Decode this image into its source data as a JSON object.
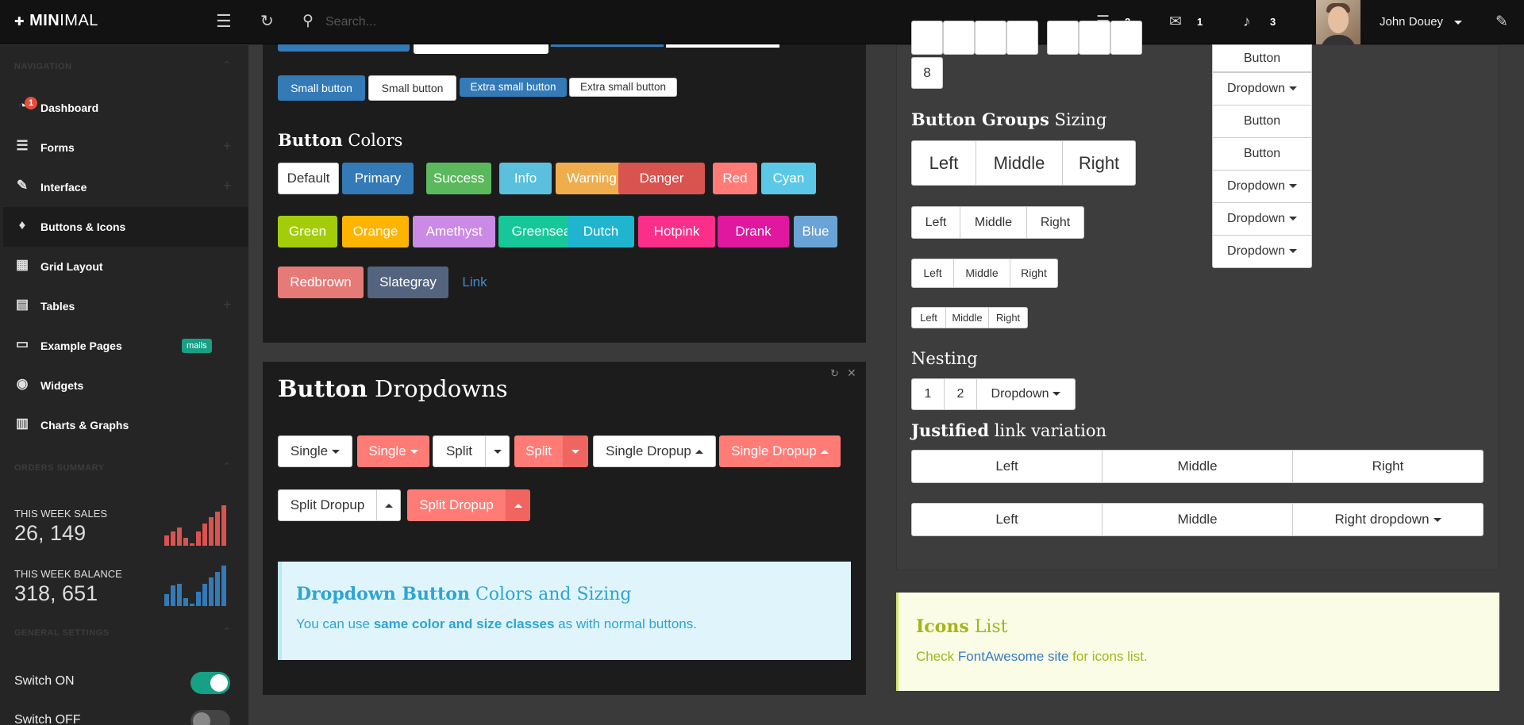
{
  "topbar": {
    "brand_bold": "MIN",
    "brand_light": "IMAL",
    "search_placeholder": "Search...",
    "counts": {
      "tasks": "2",
      "mail": "1",
      "notifications": "3"
    },
    "username": "John Douey"
  },
  "sidebar": {
    "nav_heading": "NAVIGATION",
    "items": [
      {
        "label": "Dashboard",
        "badge": "1"
      },
      {
        "label": "Forms"
      },
      {
        "label": "Interface"
      },
      {
        "label": "Buttons & Icons"
      },
      {
        "label": "Grid Layout"
      },
      {
        "label": "Tables"
      },
      {
        "label": "Example Pages",
        "badge": "mails"
      },
      {
        "label": "Widgets"
      },
      {
        "label": "Charts & Graphs"
      }
    ],
    "orders_heading": "ORDERS SUMMARY",
    "sales_label": "THIS WEEK SALES",
    "sales_value": "26, 149",
    "balance_label": "THIS WEEK BALANCE",
    "balance_value": "318, 651",
    "settings_heading": "GENERAL SETTINGS",
    "switch_on_label": "Switch ON",
    "switch_off_label": "Switch OFF",
    "switch_on": true,
    "switch_off": false,
    "sales_spark": [
      0.25,
      0.35,
      0.45,
      0.2,
      0.05,
      0.35,
      0.55,
      0.7,
      0.85,
      1.0
    ],
    "balance_spark": [
      0.3,
      0.5,
      0.55,
      0.2,
      0.05,
      0.35,
      0.55,
      0.7,
      0.85,
      1.0
    ],
    "sales_color": "#d9534f",
    "balance_color": "#337ab7"
  },
  "sizes": {
    "small": "Small button",
    "small_default": "Small button",
    "xs": "Extra small button",
    "xs_default": "Extra small button"
  },
  "colors_heading": {
    "bold": "Button",
    "light": " Colors"
  },
  "color_buttons": [
    {
      "label": "Default",
      "color": "#ffffff"
    },
    {
      "label": "Primary",
      "color": "#337ab7"
    },
    {
      "label": "Success",
      "color": "#5cb85c"
    },
    {
      "label": "Info",
      "color": "#5bc0de"
    },
    {
      "label": "Warning",
      "color": "#f0ad4e"
    },
    {
      "label": "Danger",
      "color": "#d9534f"
    },
    {
      "label": "Red",
      "color": "#ff7b76"
    },
    {
      "label": "Cyan",
      "color": "#5bc8e8"
    },
    {
      "label": "Green",
      "color": "#a3cd0a"
    },
    {
      "label": "Orange",
      "color": "#ffb400"
    },
    {
      "label": "Amethyst",
      "color": "#cb8ae6"
    },
    {
      "label": "Greensea",
      "color": "#16c79a"
    },
    {
      "label": "Dutch",
      "color": "#1fb5cf"
    },
    {
      "label": "Hotpink",
      "color": "#fb2f8a"
    },
    {
      "label": "Drank",
      "color": "#e0179f"
    },
    {
      "label": "Blue",
      "color": "#6aa3d5"
    },
    {
      "label": "Redbrown",
      "color": "#e67a77"
    },
    {
      "label": "Slategray",
      "color": "#54647f"
    },
    {
      "label": "Link",
      "color": "#428bca"
    }
  ],
  "dropdowns": {
    "heading_bold": "Button",
    "heading_light": " Dropdowns",
    "single": "Single",
    "single_red": "Single",
    "split": "Split",
    "split_red": "Split",
    "single_dropup": "Single Dropup",
    "single_dropup_red": "Single Dropup",
    "split_dropup": "Split Dropup",
    "split_dropup_red": "Split Dropup",
    "callout_title_bold": "Dropdown Button",
    "callout_title_light": " Colors and Sizing",
    "callout_text_pre": "You can use ",
    "callout_text_bold": "same color and size classes",
    "callout_text_post": " as with normal buttons."
  },
  "right": {
    "page_last": "8",
    "vertical": [
      "Button",
      "Dropdown",
      "Button",
      "Button",
      "Dropdown",
      "Dropdown",
      "Dropdown"
    ],
    "sizing_heading_bold": "Button Groups",
    "sizing_heading_light": " Sizing",
    "group_lg": [
      "Left",
      "Middle",
      "Right"
    ],
    "group_md": [
      "Left",
      "Middle",
      "Right"
    ],
    "group_sm": [
      "Left",
      "Middle",
      "Right"
    ],
    "group_xs": [
      "Left",
      "Middle",
      "Right"
    ],
    "nesting_heading": "Nesting",
    "nesting": [
      "1",
      "2",
      "Dropdown"
    ],
    "justified_heading_bold": "Justified",
    "justified_heading_light": " link variation",
    "justified1": [
      "Left",
      "Middle",
      "Right"
    ],
    "justified2": [
      "Left",
      "Middle",
      "Right dropdown"
    ],
    "icons_heading_bold": "Icons",
    "icons_heading_light": " List",
    "icons_text_pre": "Check ",
    "icons_text_link": "FontAwesome site",
    "icons_text_post": " for icons list."
  }
}
